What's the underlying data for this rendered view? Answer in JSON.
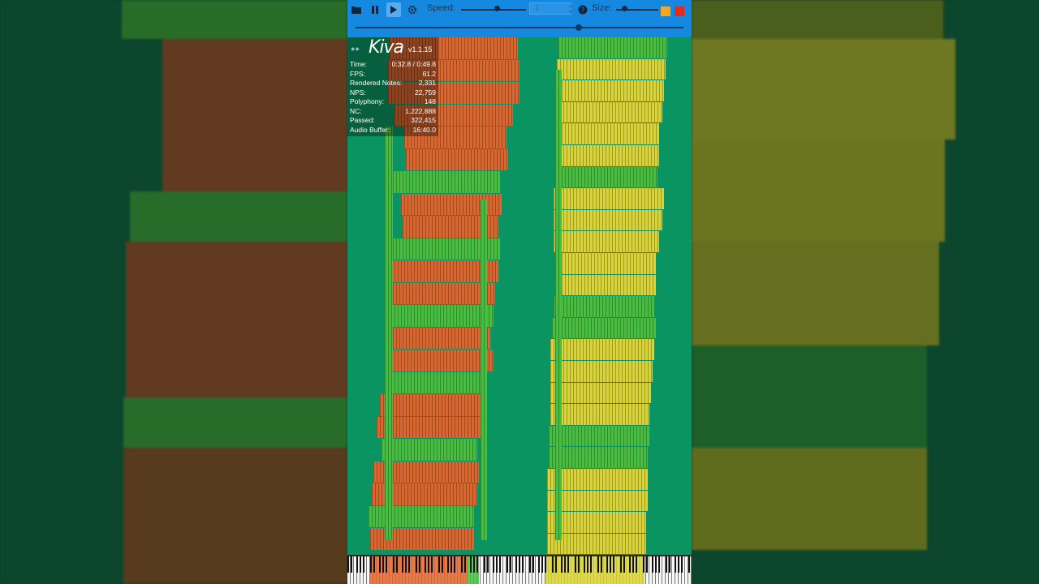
{
  "toolbar": {
    "speed_label": "Speed:",
    "speed_value": "1",
    "size_label": "Size:",
    "speed_fraction": 0.55,
    "size_fraction": 0.2,
    "playback_fraction": 0.68
  },
  "overlay": {
    "app_name": "Kiva",
    "version": "v1.1.15",
    "stats": [
      {
        "label": "Time:",
        "value": "0:32.8 / 0:49.8"
      },
      {
        "label": "FPS:",
        "value": "61.2"
      },
      {
        "label": "Rendered Notes:",
        "value": "2,331"
      },
      {
        "label": "NPS:",
        "value": "22,759"
      },
      {
        "label": "Polyphony:",
        "value": "148"
      },
      {
        "label": "NC:",
        "value": "1,222,888"
      },
      {
        "label": "Passed:",
        "value": "322,415"
      },
      {
        "label": "Audio Buffer:",
        "value": "16:40.0"
      }
    ]
  },
  "icons": {
    "open": "folder-icon",
    "pause": "pause-icon",
    "play": "play-icon",
    "settings": "gear-icon",
    "help": "help-icon",
    "minimize": "minimize-icon",
    "close": "close-icon"
  },
  "colors": {
    "toolbar": "#1589e0",
    "background": "#0a9462",
    "orange": "#e0652a",
    "green": "#42c23a",
    "yellow": "#d9d42e",
    "minimize": "#f5a623",
    "close": "#e52a1e"
  }
}
